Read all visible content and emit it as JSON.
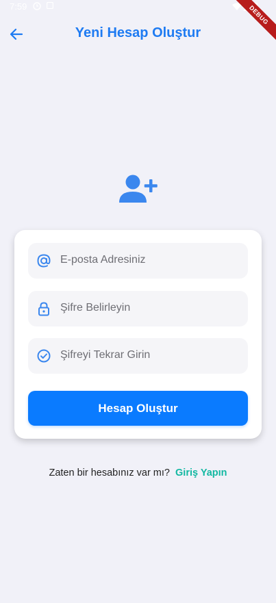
{
  "status_bar": {
    "time": "7:59"
  },
  "debug_banner": {
    "label": "DEBUG"
  },
  "app_bar": {
    "title": "Yeni Hesap Oluştur"
  },
  "form": {
    "email_placeholder": "E-posta Adresiniz",
    "password_placeholder": "Şifre Belirleyin",
    "confirm_placeholder": "Şifreyi Tekrar Girin",
    "submit_label": "Hesap Oluştur"
  },
  "footer": {
    "prompt": "Zaten bir hesabınız var mı?",
    "link_label": "Giriş Yapın"
  },
  "colors": {
    "primary": "#0a7bff",
    "accent_icon": "#3b87ee",
    "link": "#13b8a2",
    "background": "#f1f1f8"
  }
}
